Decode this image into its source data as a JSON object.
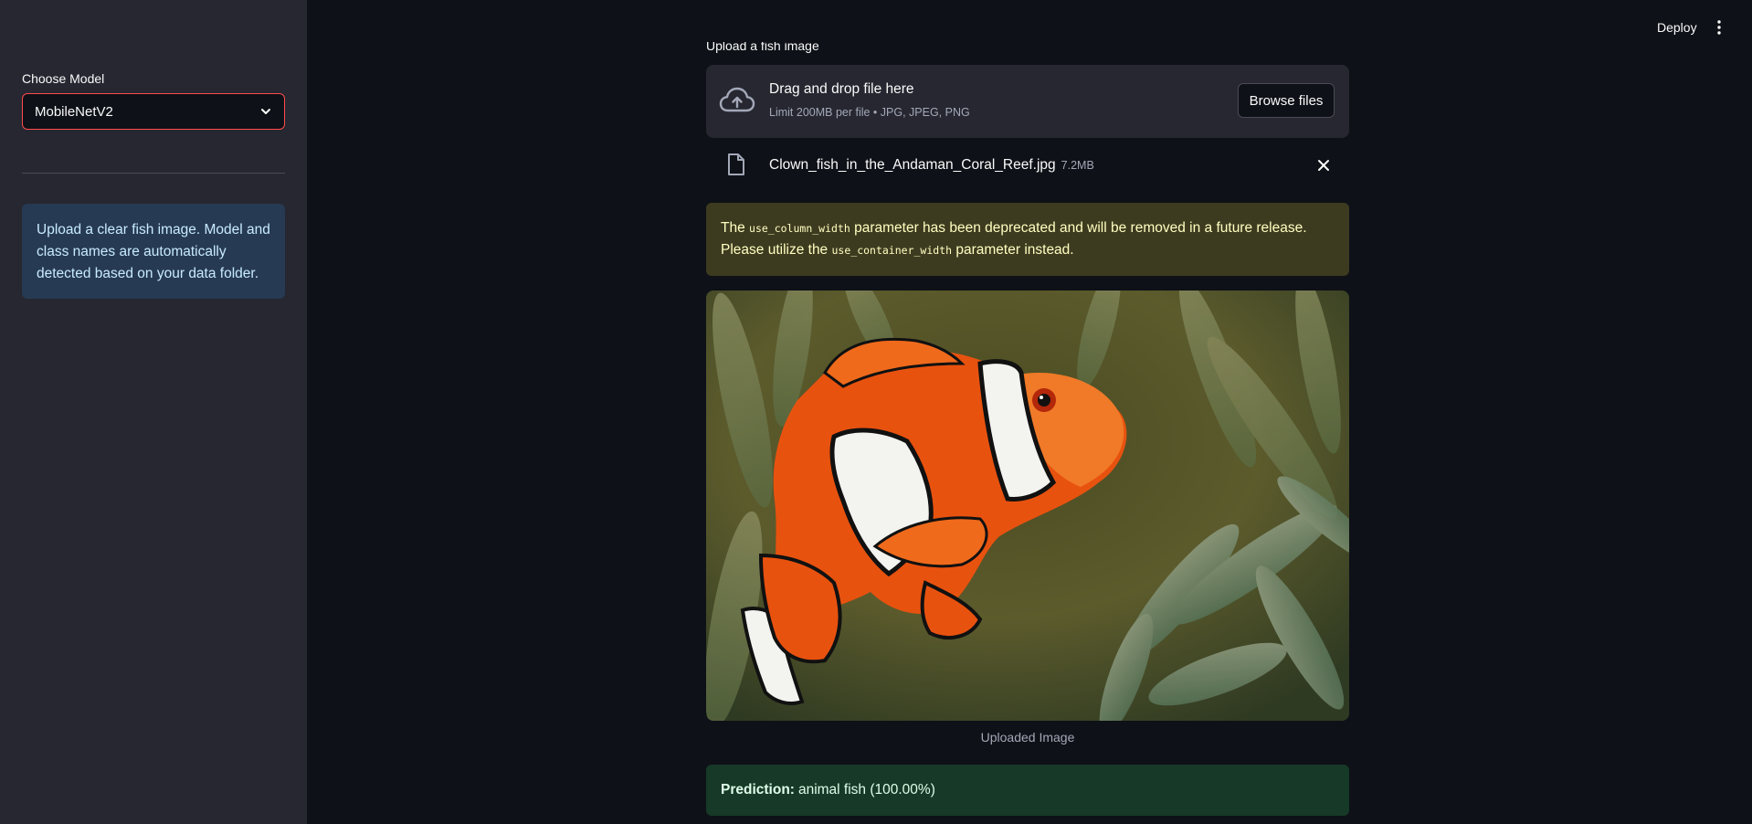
{
  "header": {
    "deploy_label": "Deploy",
    "menu_icon": "kebab-menu-icon"
  },
  "sidebar": {
    "model_label": "Choose Model",
    "model_selected": "MobileNetV2",
    "info_text": "Upload a clear fish image. Model and class names are automatically detected based on your data folder."
  },
  "uploader": {
    "label": "Upload a fish image",
    "drop_title": "Drag and drop file here",
    "drop_sub": "Limit 200MB per file • JPG, JPEG, PNG",
    "browse_label": "Browse files",
    "file_name": "Clown_fish_in_the_Andaman_Coral_Reef.jpg",
    "file_size": "7.2MB"
  },
  "warning": {
    "t1": "The ",
    "code1": "use_column_width",
    "t2": " parameter has been deprecated and will be removed in a future release. Please utilize the ",
    "code2": "use_container_width",
    "t3": " parameter instead."
  },
  "image": {
    "caption": "Uploaded Image"
  },
  "result": {
    "label": "Prediction:",
    "value": "animal fish (100.00%)"
  },
  "colors": {
    "background": "#0e1117",
    "sidebar": "#262730",
    "accent": "#ff4b4b",
    "info_bg": "#273a53",
    "warning_bg": "#3d3b1f",
    "success_bg": "#173928"
  }
}
